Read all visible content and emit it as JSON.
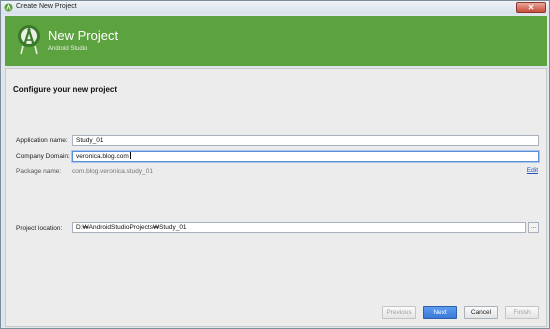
{
  "window": {
    "title": "Create New Project"
  },
  "header": {
    "title": "New Project",
    "subtitle": "Android Studio"
  },
  "main": {
    "section_title": "Configure your new project",
    "application_name": {
      "label": "Application name:",
      "value": "Study_01"
    },
    "company_domain": {
      "label": "Company Domain:",
      "value": "veronica.blog.com"
    },
    "package_name": {
      "label": "Package name:",
      "value": "com.blog.veronica.study_01",
      "edit_label": "Edit"
    },
    "project_location": {
      "label": "Project location:",
      "value": "D:₩AndroidStudioProjects₩Study_01",
      "browse_label": "..."
    }
  },
  "footer": {
    "previous": "Previous",
    "next": "Next",
    "cancel": "Cancel",
    "finish": "Finish"
  },
  "colors": {
    "header_bg": "#5ca23e",
    "primary_button": "#3a78d8"
  }
}
